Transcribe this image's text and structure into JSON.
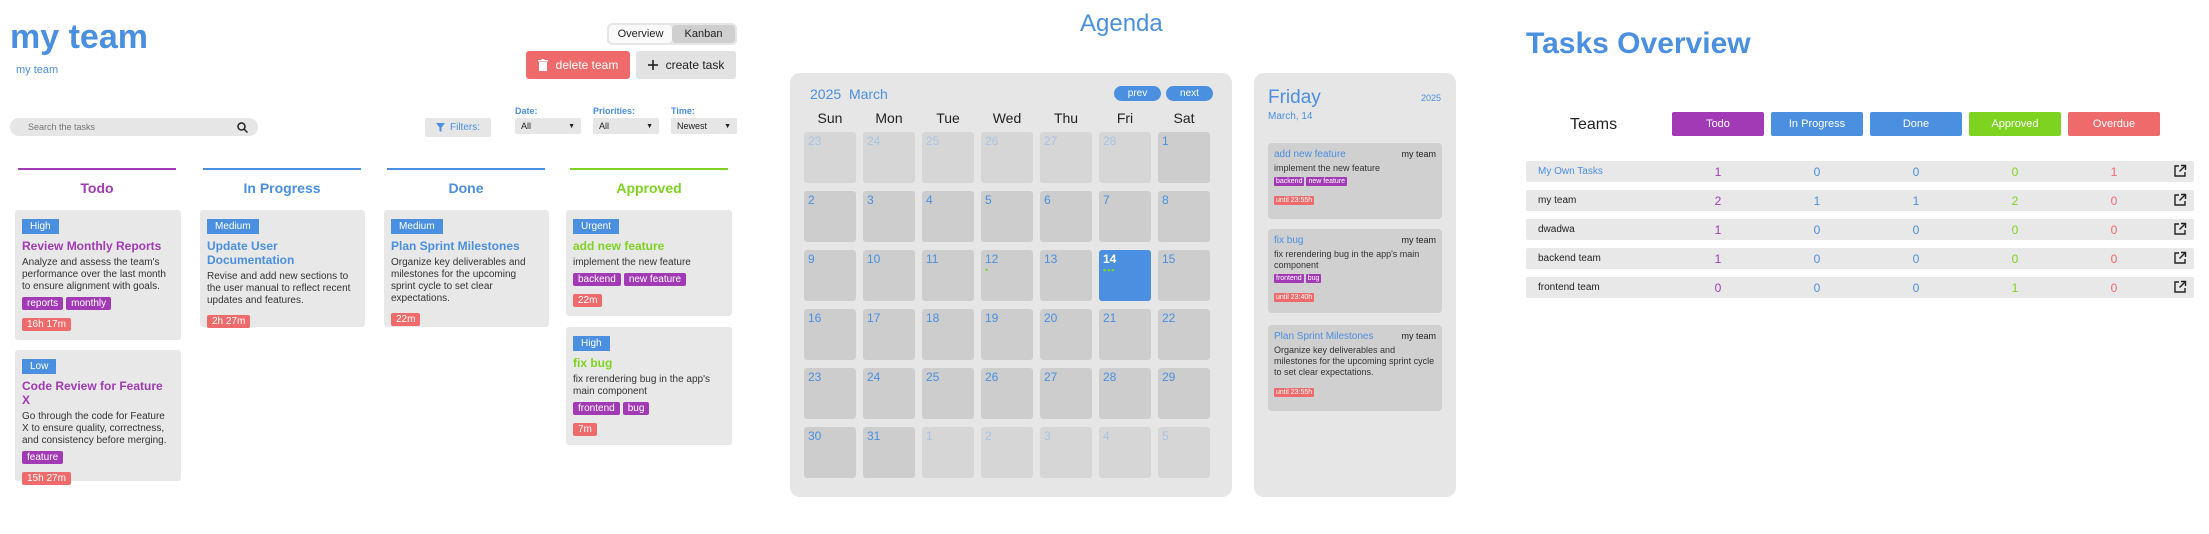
{
  "team": {
    "title": "my team",
    "subtitle": "my team",
    "view_toggle": {
      "overview": "Overview",
      "kanban": "Kanban"
    },
    "delete_label": "delete team",
    "create_label": "create task",
    "search_placeholder": "Search the tasks",
    "filters_label": "Filters:",
    "filters": {
      "date": {
        "label": "Date:",
        "value": "All"
      },
      "priorities": {
        "label": "Priorities:",
        "value": "All"
      },
      "time": {
        "label": "Time:",
        "value": "Newest"
      }
    }
  },
  "kanban": {
    "columns": [
      {
        "title": "Todo",
        "color": "#a13ab4",
        "cards": [
          {
            "priority": "High",
            "title": "Review Monthly Reports",
            "desc": "Analyze and assess the team's performance over the last month to ensure alignment with goals.",
            "tags": [
              "reports",
              "monthly"
            ],
            "time": "16h 17m"
          },
          {
            "priority": "Low",
            "title": "Code Review for Feature X",
            "desc": "Go through the code for Feature X to ensure quality, correctness, and consistency before merging.",
            "tags": [
              "feature"
            ],
            "time": "15h 27m"
          }
        ]
      },
      {
        "title": "In Progress",
        "color": "#4a8fe0",
        "cards": [
          {
            "priority": "Medium",
            "title": "Update User Documentation",
            "desc": "Revise and add new sections to the user manual to reflect recent updates and features.",
            "tags": [],
            "time": "2h 27m"
          }
        ]
      },
      {
        "title": "Done",
        "color": "#4a8fe0",
        "cards": [
          {
            "priority": "Medium",
            "title": "Plan Sprint Milestones",
            "desc": "Organize key deliverables and milestones for the upcoming sprint cycle to set clear expectations.",
            "tags": [],
            "time": "22m"
          }
        ]
      },
      {
        "title": "Approved",
        "color": "#7ed321",
        "cards": [
          {
            "priority": "Urgent",
            "title": "add new feature",
            "desc": "implement the new feature",
            "tags": [
              "backend",
              "new feature"
            ],
            "time": "22m"
          },
          {
            "priority": "High",
            "title": "fix bug",
            "desc": "fix rerendering bug in the app's main component",
            "tags": [
              "frontend",
              "bug"
            ],
            "time": "7m"
          }
        ]
      }
    ]
  },
  "agenda": {
    "title": "Agenda",
    "year": "2025",
    "month": "March",
    "prev": "prev",
    "next": "next",
    "weekdays": [
      "Sun",
      "Mon",
      "Tue",
      "Wed",
      "Thu",
      "Fri",
      "Sat"
    ],
    "days": [
      {
        "d": "23",
        "m": "other"
      },
      {
        "d": "24",
        "m": "other"
      },
      {
        "d": "25",
        "m": "other"
      },
      {
        "d": "26",
        "m": "other"
      },
      {
        "d": "27",
        "m": "other"
      },
      {
        "d": "28",
        "m": "other"
      },
      {
        "d": "1",
        "m": "cur"
      },
      {
        "d": "2",
        "m": "cur"
      },
      {
        "d": "3",
        "m": "cur"
      },
      {
        "d": "4",
        "m": "cur"
      },
      {
        "d": "5",
        "m": "cur"
      },
      {
        "d": "6",
        "m": "cur"
      },
      {
        "d": "7",
        "m": "cur"
      },
      {
        "d": "8",
        "m": "cur"
      },
      {
        "d": "9",
        "m": "cur"
      },
      {
        "d": "10",
        "m": "cur"
      },
      {
        "d": "11",
        "m": "cur"
      },
      {
        "d": "12",
        "m": "cur",
        "dots": "•"
      },
      {
        "d": "13",
        "m": "cur"
      },
      {
        "d": "14",
        "m": "today",
        "dots": "•••"
      },
      {
        "d": "15",
        "m": "cur"
      },
      {
        "d": "16",
        "m": "cur"
      },
      {
        "d": "17",
        "m": "cur"
      },
      {
        "d": "18",
        "m": "cur"
      },
      {
        "d": "19",
        "m": "cur"
      },
      {
        "d": "20",
        "m": "cur"
      },
      {
        "d": "21",
        "m": "cur"
      },
      {
        "d": "22",
        "m": "cur"
      },
      {
        "d": "23",
        "m": "cur"
      },
      {
        "d": "24",
        "m": "cur"
      },
      {
        "d": "25",
        "m": "cur"
      },
      {
        "d": "26",
        "m": "cur"
      },
      {
        "d": "27",
        "m": "cur"
      },
      {
        "d": "28",
        "m": "cur"
      },
      {
        "d": "29",
        "m": "cur"
      },
      {
        "d": "30",
        "m": "cur"
      },
      {
        "d": "31",
        "m": "cur"
      },
      {
        "d": "1",
        "m": "other"
      },
      {
        "d": "2",
        "m": "other"
      },
      {
        "d": "3",
        "m": "other"
      },
      {
        "d": "4",
        "m": "other"
      },
      {
        "d": "5",
        "m": "other"
      }
    ],
    "day_panel": {
      "weekday": "Friday",
      "year": "2025",
      "date": "March, 14",
      "tasks": [
        {
          "title": "add new feature",
          "team": "my team",
          "desc": "implement the new feature",
          "tags": [
            "backend",
            "new feature"
          ],
          "until": "until 23:55h"
        },
        {
          "title": "fix bug",
          "team": "my team",
          "desc": "fix rerendering bug in the app's main component",
          "tags": [
            "frontend",
            "bug"
          ],
          "until": "until 23:40h"
        },
        {
          "title": "Plan Sprint Milestones",
          "team": "my team",
          "desc": "Organize key deliverables and milestones for the upcoming sprint cycle to set clear expectations.",
          "tags": [],
          "until": "until 23:55h"
        }
      ]
    }
  },
  "overview": {
    "title": "Tasks Overview",
    "teams_label": "Teams",
    "columns": [
      {
        "label": "Todo",
        "color": "#a13ab4"
      },
      {
        "label": "In Progress",
        "color": "#4a8fe0"
      },
      {
        "label": "Done",
        "color": "#4a8fe0"
      },
      {
        "label": "Approved",
        "color": "#7ed321"
      },
      {
        "label": "Overdue",
        "color": "#ef6b6b"
      }
    ],
    "rows": [
      {
        "name": "My Own Tasks",
        "values": [
          "1",
          "0",
          "0",
          "0",
          "1"
        ]
      },
      {
        "name": "my team",
        "values": [
          "2",
          "1",
          "1",
          "2",
          "0"
        ]
      },
      {
        "name": "dwadwa",
        "values": [
          "1",
          "0",
          "0",
          "0",
          "0"
        ]
      },
      {
        "name": "backend team",
        "values": [
          "1",
          "0",
          "0",
          "0",
          "0"
        ]
      },
      {
        "name": "frontend team",
        "values": [
          "0",
          "0",
          "0",
          "1",
          "0"
        ]
      }
    ]
  }
}
